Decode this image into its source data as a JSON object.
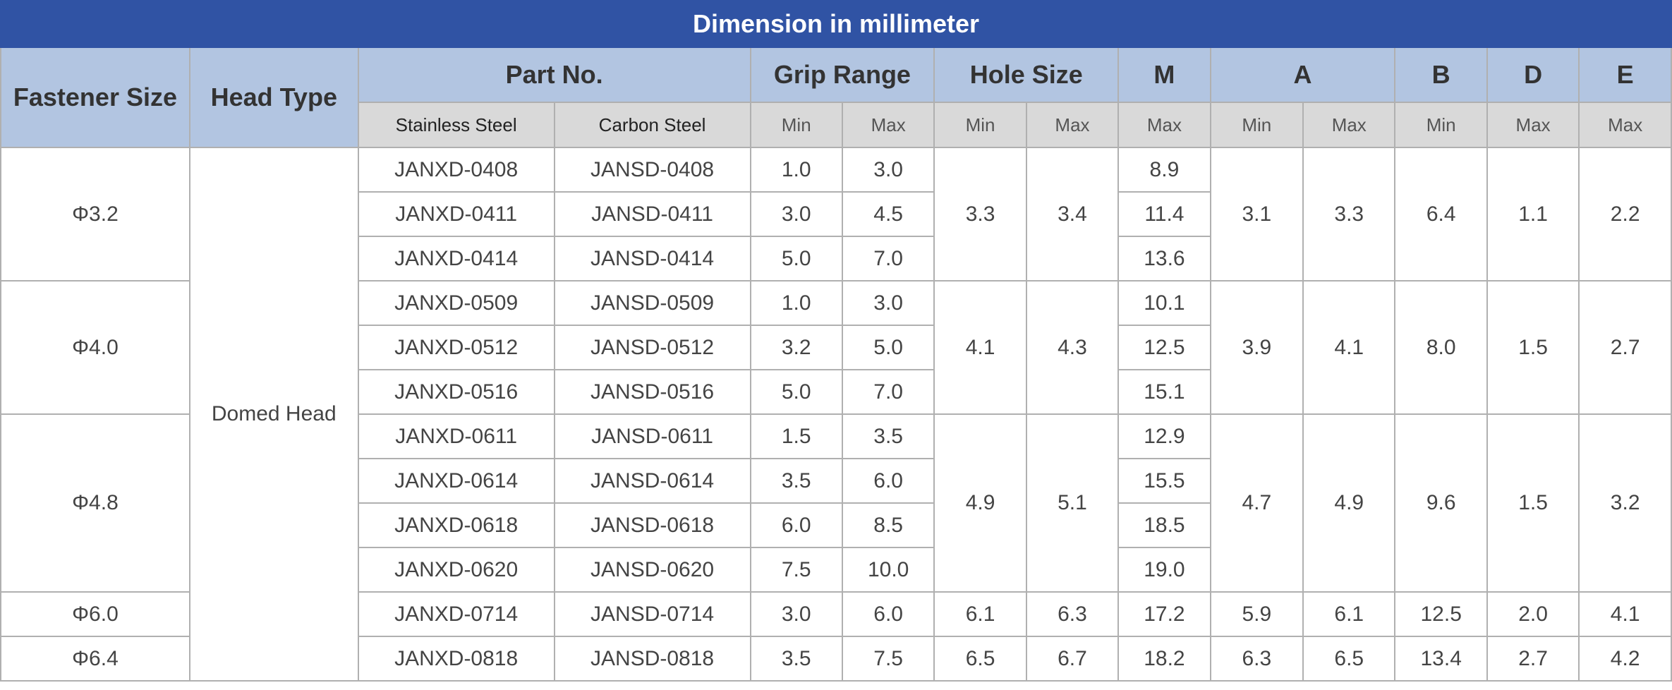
{
  "title": "Dimension in millimeter",
  "headers": {
    "fastener_size": "Fastener Size",
    "head_type": "Head Type",
    "part_no": "Part No.",
    "grip_range": "Grip Range",
    "hole_size": "Hole Size",
    "m": "M",
    "a": "A",
    "b": "B",
    "d": "D",
    "e": "E",
    "stainless_steel": "Stainless Steel",
    "carbon_steel": "Carbon Steel",
    "min": "Min",
    "max": "Max"
  },
  "head_type_value": "Domed Head",
  "groups": [
    {
      "size": "Φ3.2",
      "hole_min": "3.3",
      "hole_max": "3.4",
      "a_min": "3.1",
      "a_max": "3.3",
      "b_min": "6.4",
      "d_max": "1.1",
      "e_max": "2.2",
      "rows": [
        {
          "ss": "JANXD-0408",
          "cs": "JANSD-0408",
          "grip_min": "1.0",
          "grip_max": "3.0",
          "m_max": "8.9"
        },
        {
          "ss": "JANXD-0411",
          "cs": "JANSD-0411",
          "grip_min": "3.0",
          "grip_max": "4.5",
          "m_max": "11.4"
        },
        {
          "ss": "JANXD-0414",
          "cs": "JANSD-0414",
          "grip_min": "5.0",
          "grip_max": "7.0",
          "m_max": "13.6"
        }
      ]
    },
    {
      "size": "Φ4.0",
      "hole_min": "4.1",
      "hole_max": "4.3",
      "a_min": "3.9",
      "a_max": "4.1",
      "b_min": "8.0",
      "d_max": "1.5",
      "e_max": "2.7",
      "rows": [
        {
          "ss": "JANXD-0509",
          "cs": "JANSD-0509",
          "grip_min": "1.0",
          "grip_max": "3.0",
          "m_max": "10.1"
        },
        {
          "ss": "JANXD-0512",
          "cs": "JANSD-0512",
          "grip_min": "3.2",
          "grip_max": "5.0",
          "m_max": "12.5"
        },
        {
          "ss": "JANXD-0516",
          "cs": "JANSD-0516",
          "grip_min": "5.0",
          "grip_max": "7.0",
          "m_max": "15.1"
        }
      ]
    },
    {
      "size": "Φ4.8",
      "hole_min": "4.9",
      "hole_max": "5.1",
      "a_min": "4.7",
      "a_max": "4.9",
      "b_min": "9.6",
      "d_max": "1.5",
      "e_max": "3.2",
      "rows": [
        {
          "ss": "JANXD-0611",
          "cs": "JANSD-0611",
          "grip_min": "1.5",
          "grip_max": "3.5",
          "m_max": "12.9"
        },
        {
          "ss": "JANXD-0614",
          "cs": "JANSD-0614",
          "grip_min": "3.5",
          "grip_max": "6.0",
          "m_max": "15.5"
        },
        {
          "ss": "JANXD-0618",
          "cs": "JANSD-0618",
          "grip_min": "6.0",
          "grip_max": "8.5",
          "m_max": "18.5"
        },
        {
          "ss": "JANXD-0620",
          "cs": "JANSD-0620",
          "grip_min": "7.5",
          "grip_max": "10.0",
          "m_max": "19.0"
        }
      ]
    },
    {
      "size": "Φ6.0",
      "hole_min": "6.1",
      "hole_max": "6.3",
      "a_min": "5.9",
      "a_max": "6.1",
      "b_min": "12.5",
      "d_max": "2.0",
      "e_max": "4.1",
      "rows": [
        {
          "ss": "JANXD-0714",
          "cs": "JANSD-0714",
          "grip_min": "3.0",
          "grip_max": "6.0",
          "m_max": "17.2"
        }
      ]
    },
    {
      "size": "Φ6.4",
      "hole_min": "6.5",
      "hole_max": "6.7",
      "a_min": "6.3",
      "a_max": "6.5",
      "b_min": "13.4",
      "d_max": "2.7",
      "e_max": "4.2",
      "rows": [
        {
          "ss": "JANXD-0818",
          "cs": "JANSD-0818",
          "grip_min": "3.5",
          "grip_max": "7.5",
          "m_max": "18.2"
        }
      ]
    }
  ],
  "colors": {
    "title_bg": "#3053a4",
    "header_bg": "#b2c5e1",
    "subheader_bg": "#d9d9d9",
    "border": "#b0b0b0"
  }
}
